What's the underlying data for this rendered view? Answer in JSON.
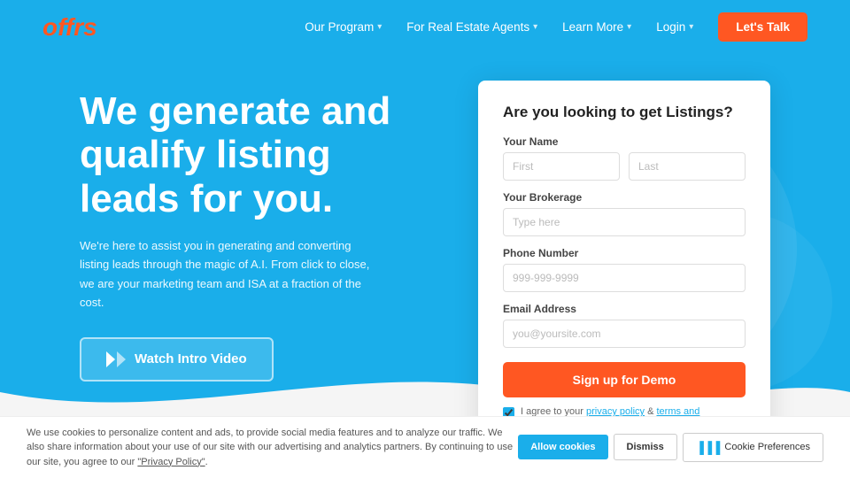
{
  "brand": {
    "logo": "offrs",
    "logo_color": "orange"
  },
  "nav": {
    "links": [
      {
        "label": "Our Program",
        "has_caret": true
      },
      {
        "label": "For Real Estate Agents",
        "has_caret": true
      },
      {
        "label": "Learn More",
        "has_caret": true
      },
      {
        "label": "Login",
        "has_caret": true
      }
    ],
    "cta": "Let's Talk"
  },
  "hero": {
    "title": "We generate and qualify listing leads for you.",
    "subtitle": "We're here to assist you in generating and converting listing leads through the magic of A.I. From click to close, we are your marketing team and ISA at a fraction of the cost.",
    "watch_btn": "Watch Intro Video"
  },
  "form": {
    "title": "Are you looking to get Listings?",
    "name_label": "Your Name",
    "first_placeholder": "First",
    "last_placeholder": "Last",
    "brokerage_label": "Your Brokerage",
    "brokerage_placeholder": "Type here",
    "phone_label": "Phone Number",
    "phone_placeholder": "999-999-9999",
    "email_label": "Email Address",
    "email_placeholder": "you@yoursite.com",
    "submit_btn": "Sign up for Demo",
    "agree_text": "I agree to your ",
    "agree_link1": "privacy policy",
    "agree_and": " & ",
    "agree_link2": "terms and conditions",
    "agree_period": "."
  },
  "cookie": {
    "text": "We use cookies to personalize content and ads, to provide social media features and to analyze our traffic. We also share information about your use of our site with our advertising and analytics partners. By continuing to use our site, you agree to our ",
    "link_text": "\"Privacy Policy\"",
    "period": ".",
    "allow_btn": "Allow cookies",
    "dismiss_btn": "Dismiss",
    "prefs_btn": "Cookie Preferences"
  }
}
